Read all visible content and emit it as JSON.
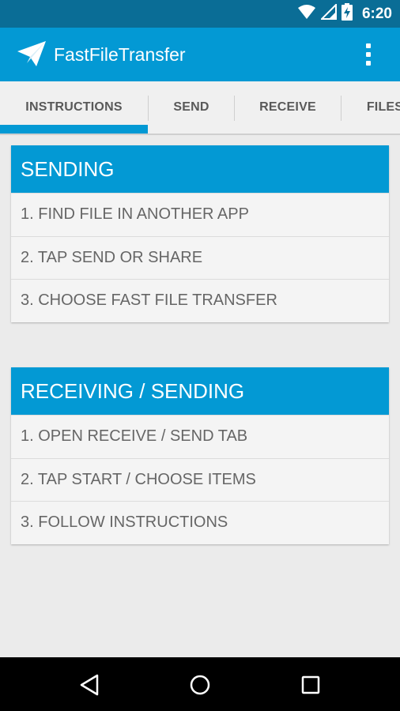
{
  "status_bar": {
    "time": "6:20",
    "icons": [
      "wifi-icon",
      "signal-icon",
      "battery-charging-icon"
    ]
  },
  "app_bar": {
    "title": "FastFileTransfer",
    "logo_icon": "paper-plane-icon",
    "menu_icon": "overflow-menu-icon"
  },
  "tabs": [
    {
      "label": "INSTRUCTIONS",
      "selected": true
    },
    {
      "label": "SEND",
      "selected": false
    },
    {
      "label": "RECEIVE",
      "selected": false
    },
    {
      "label": "FILES",
      "selected": false
    }
  ],
  "cards": [
    {
      "title": "SENDING",
      "steps": [
        "1. FIND FILE IN ANOTHER APP",
        "2. TAP SEND OR SHARE",
        "3. CHOOSE FAST FILE TRANSFER"
      ]
    },
    {
      "title": "RECEIVING / SENDING",
      "steps": [
        "1. OPEN RECEIVE / SEND TAB",
        "2. TAP START / CHOOSE ITEMS",
        "3. FOLLOW INSTRUCTIONS"
      ]
    }
  ],
  "nav_bar": {
    "buttons": [
      "back-icon",
      "home-icon",
      "recents-icon"
    ]
  },
  "colors": {
    "primary": "#0399d4",
    "primary_dark": "#0a6d96",
    "background": "#ebebeb",
    "card": "#f4f4f4",
    "text_secondary": "#666666"
  }
}
